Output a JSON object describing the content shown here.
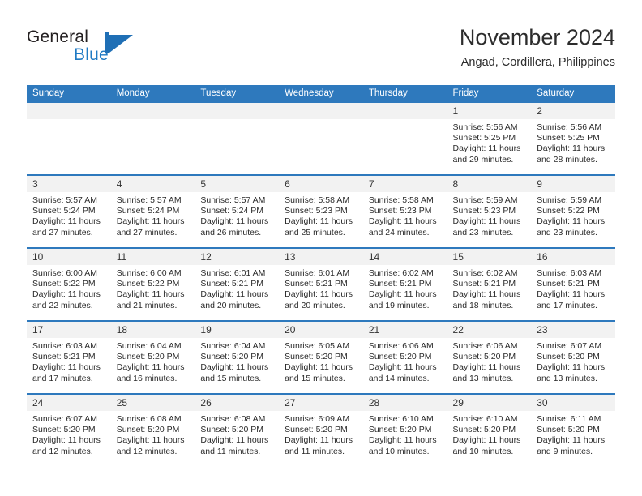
{
  "brand": {
    "name_part1": "General",
    "name_part2": "Blue",
    "mark_icon": "triangle-logo-icon"
  },
  "header": {
    "month_title": "November 2024",
    "location": "Angad, Cordillera, Philippines"
  },
  "colors": {
    "header_blue": "#2e79bd",
    "brand_blue": "#1f7ac4",
    "daynum_band": "#f2f2f2",
    "text": "#2b2b2b"
  },
  "weekday_headers": [
    "Sunday",
    "Monday",
    "Tuesday",
    "Wednesday",
    "Thursday",
    "Friday",
    "Saturday"
  ],
  "weeks": [
    [
      {
        "day": "",
        "sunrise": "",
        "sunset": "",
        "daylight1": "",
        "daylight2": ""
      },
      {
        "day": "",
        "sunrise": "",
        "sunset": "",
        "daylight1": "",
        "daylight2": ""
      },
      {
        "day": "",
        "sunrise": "",
        "sunset": "",
        "daylight1": "",
        "daylight2": ""
      },
      {
        "day": "",
        "sunrise": "",
        "sunset": "",
        "daylight1": "",
        "daylight2": ""
      },
      {
        "day": "",
        "sunrise": "",
        "sunset": "",
        "daylight1": "",
        "daylight2": ""
      },
      {
        "day": "1",
        "sunrise": "Sunrise: 5:56 AM",
        "sunset": "Sunset: 5:25 PM",
        "daylight1": "Daylight: 11 hours",
        "daylight2": "and 29 minutes."
      },
      {
        "day": "2",
        "sunrise": "Sunrise: 5:56 AM",
        "sunset": "Sunset: 5:25 PM",
        "daylight1": "Daylight: 11 hours",
        "daylight2": "and 28 minutes."
      }
    ],
    [
      {
        "day": "3",
        "sunrise": "Sunrise: 5:57 AM",
        "sunset": "Sunset: 5:24 PM",
        "daylight1": "Daylight: 11 hours",
        "daylight2": "and 27 minutes."
      },
      {
        "day": "4",
        "sunrise": "Sunrise: 5:57 AM",
        "sunset": "Sunset: 5:24 PM",
        "daylight1": "Daylight: 11 hours",
        "daylight2": "and 27 minutes."
      },
      {
        "day": "5",
        "sunrise": "Sunrise: 5:57 AM",
        "sunset": "Sunset: 5:24 PM",
        "daylight1": "Daylight: 11 hours",
        "daylight2": "and 26 minutes."
      },
      {
        "day": "6",
        "sunrise": "Sunrise: 5:58 AM",
        "sunset": "Sunset: 5:23 PM",
        "daylight1": "Daylight: 11 hours",
        "daylight2": "and 25 minutes."
      },
      {
        "day": "7",
        "sunrise": "Sunrise: 5:58 AM",
        "sunset": "Sunset: 5:23 PM",
        "daylight1": "Daylight: 11 hours",
        "daylight2": "and 24 minutes."
      },
      {
        "day": "8",
        "sunrise": "Sunrise: 5:59 AM",
        "sunset": "Sunset: 5:23 PM",
        "daylight1": "Daylight: 11 hours",
        "daylight2": "and 23 minutes."
      },
      {
        "day": "9",
        "sunrise": "Sunrise: 5:59 AM",
        "sunset": "Sunset: 5:22 PM",
        "daylight1": "Daylight: 11 hours",
        "daylight2": "and 23 minutes."
      }
    ],
    [
      {
        "day": "10",
        "sunrise": "Sunrise: 6:00 AM",
        "sunset": "Sunset: 5:22 PM",
        "daylight1": "Daylight: 11 hours",
        "daylight2": "and 22 minutes."
      },
      {
        "day": "11",
        "sunrise": "Sunrise: 6:00 AM",
        "sunset": "Sunset: 5:22 PM",
        "daylight1": "Daylight: 11 hours",
        "daylight2": "and 21 minutes."
      },
      {
        "day": "12",
        "sunrise": "Sunrise: 6:01 AM",
        "sunset": "Sunset: 5:21 PM",
        "daylight1": "Daylight: 11 hours",
        "daylight2": "and 20 minutes."
      },
      {
        "day": "13",
        "sunrise": "Sunrise: 6:01 AM",
        "sunset": "Sunset: 5:21 PM",
        "daylight1": "Daylight: 11 hours",
        "daylight2": "and 20 minutes."
      },
      {
        "day": "14",
        "sunrise": "Sunrise: 6:02 AM",
        "sunset": "Sunset: 5:21 PM",
        "daylight1": "Daylight: 11 hours",
        "daylight2": "and 19 minutes."
      },
      {
        "day": "15",
        "sunrise": "Sunrise: 6:02 AM",
        "sunset": "Sunset: 5:21 PM",
        "daylight1": "Daylight: 11 hours",
        "daylight2": "and 18 minutes."
      },
      {
        "day": "16",
        "sunrise": "Sunrise: 6:03 AM",
        "sunset": "Sunset: 5:21 PM",
        "daylight1": "Daylight: 11 hours",
        "daylight2": "and 17 minutes."
      }
    ],
    [
      {
        "day": "17",
        "sunrise": "Sunrise: 6:03 AM",
        "sunset": "Sunset: 5:21 PM",
        "daylight1": "Daylight: 11 hours",
        "daylight2": "and 17 minutes."
      },
      {
        "day": "18",
        "sunrise": "Sunrise: 6:04 AM",
        "sunset": "Sunset: 5:20 PM",
        "daylight1": "Daylight: 11 hours",
        "daylight2": "and 16 minutes."
      },
      {
        "day": "19",
        "sunrise": "Sunrise: 6:04 AM",
        "sunset": "Sunset: 5:20 PM",
        "daylight1": "Daylight: 11 hours",
        "daylight2": "and 15 minutes."
      },
      {
        "day": "20",
        "sunrise": "Sunrise: 6:05 AM",
        "sunset": "Sunset: 5:20 PM",
        "daylight1": "Daylight: 11 hours",
        "daylight2": "and 15 minutes."
      },
      {
        "day": "21",
        "sunrise": "Sunrise: 6:06 AM",
        "sunset": "Sunset: 5:20 PM",
        "daylight1": "Daylight: 11 hours",
        "daylight2": "and 14 minutes."
      },
      {
        "day": "22",
        "sunrise": "Sunrise: 6:06 AM",
        "sunset": "Sunset: 5:20 PM",
        "daylight1": "Daylight: 11 hours",
        "daylight2": "and 13 minutes."
      },
      {
        "day": "23",
        "sunrise": "Sunrise: 6:07 AM",
        "sunset": "Sunset: 5:20 PM",
        "daylight1": "Daylight: 11 hours",
        "daylight2": "and 13 minutes."
      }
    ],
    [
      {
        "day": "24",
        "sunrise": "Sunrise: 6:07 AM",
        "sunset": "Sunset: 5:20 PM",
        "daylight1": "Daylight: 11 hours",
        "daylight2": "and 12 minutes."
      },
      {
        "day": "25",
        "sunrise": "Sunrise: 6:08 AM",
        "sunset": "Sunset: 5:20 PM",
        "daylight1": "Daylight: 11 hours",
        "daylight2": "and 12 minutes."
      },
      {
        "day": "26",
        "sunrise": "Sunrise: 6:08 AM",
        "sunset": "Sunset: 5:20 PM",
        "daylight1": "Daylight: 11 hours",
        "daylight2": "and 11 minutes."
      },
      {
        "day": "27",
        "sunrise": "Sunrise: 6:09 AM",
        "sunset": "Sunset: 5:20 PM",
        "daylight1": "Daylight: 11 hours",
        "daylight2": "and 11 minutes."
      },
      {
        "day": "28",
        "sunrise": "Sunrise: 6:10 AM",
        "sunset": "Sunset: 5:20 PM",
        "daylight1": "Daylight: 11 hours",
        "daylight2": "and 10 minutes."
      },
      {
        "day": "29",
        "sunrise": "Sunrise: 6:10 AM",
        "sunset": "Sunset: 5:20 PM",
        "daylight1": "Daylight: 11 hours",
        "daylight2": "and 10 minutes."
      },
      {
        "day": "30",
        "sunrise": "Sunrise: 6:11 AM",
        "sunset": "Sunset: 5:20 PM",
        "daylight1": "Daylight: 11 hours",
        "daylight2": "and 9 minutes."
      }
    ]
  ]
}
